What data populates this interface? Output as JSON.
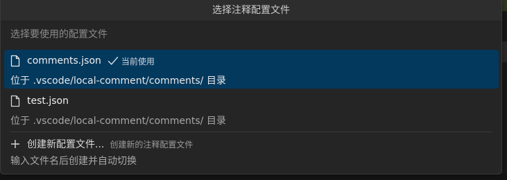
{
  "picker": {
    "title": "选择注释配置文件",
    "placeholder": "选择要使用的配置文件",
    "items": [
      {
        "icon": "file-icon",
        "label": "comments.json",
        "badge_icon": "check-icon",
        "badge": "当前使用",
        "description": "位于 .vscode/local-comment/comments/ 目录",
        "selected": true
      },
      {
        "icon": "file-icon",
        "label": "test.json",
        "description": "位于 .vscode/local-comment/comments/ 目录",
        "selected": false
      }
    ],
    "create": {
      "icon": "plus-icon",
      "label": "创建新配置文件...",
      "detail": "创建新的注释配置文件",
      "description": "输入文件名后创建并自动切换"
    }
  },
  "colors": {
    "panel_bg": "#252526",
    "title_bg": "#2d2d2d",
    "selected_bg": "#04395e",
    "text": "#cccccc"
  }
}
